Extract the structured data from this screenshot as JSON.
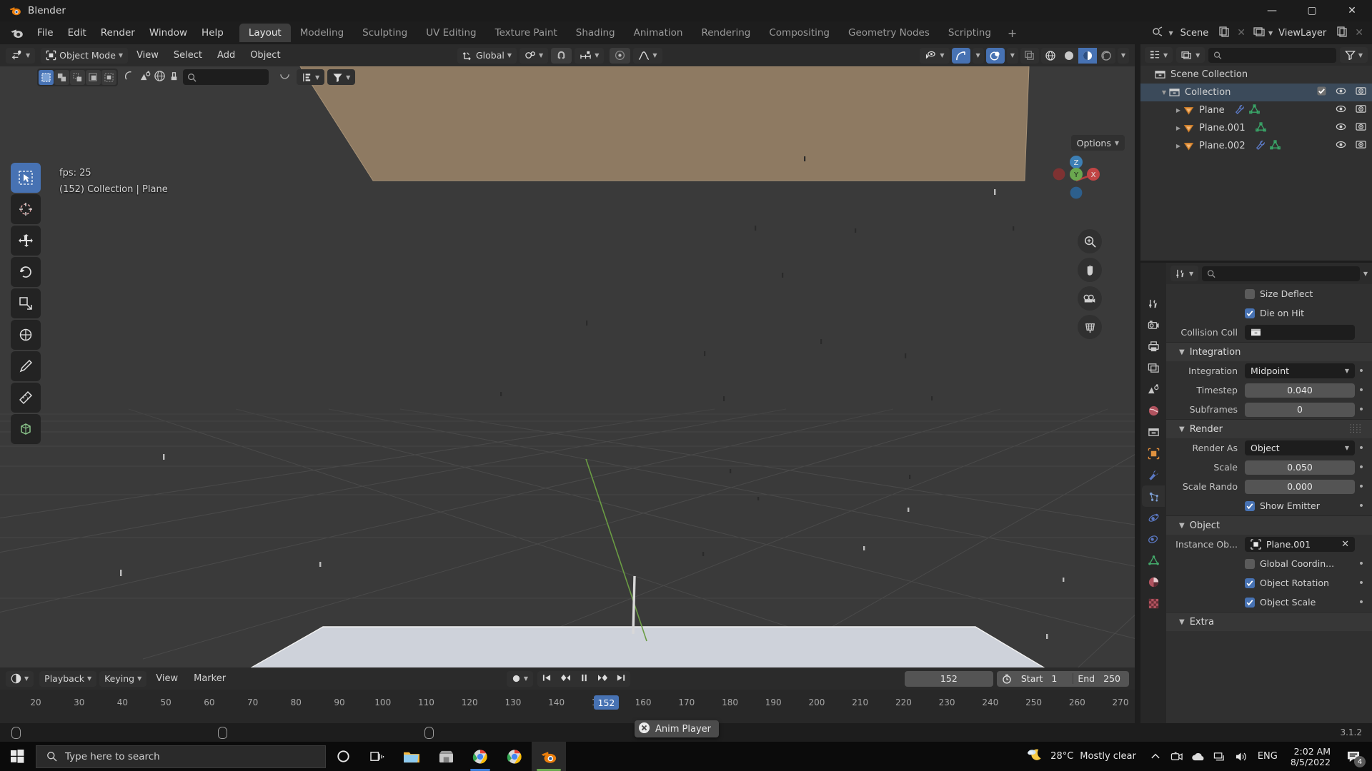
{
  "window": {
    "title": "Blender",
    "controls": {
      "minimize": "—",
      "maximize": "▢",
      "close": "✕"
    }
  },
  "topbar": {
    "menus": [
      "File",
      "Edit",
      "Render",
      "Window",
      "Help"
    ],
    "workspaces": [
      "Layout",
      "Modeling",
      "Sculpting",
      "UV Editing",
      "Texture Paint",
      "Shading",
      "Animation",
      "Rendering",
      "Compositing",
      "Geometry Nodes",
      "Scripting"
    ],
    "active_workspace": "Layout",
    "add_workspace": "+",
    "scene_name": "Scene",
    "view_layer_name": "ViewLayer"
  },
  "viewport": {
    "mode": "Object Mode",
    "menus": [
      "View",
      "Select",
      "Add",
      "Object"
    ],
    "transform_orientation": "Global",
    "options_label": "Options",
    "overlay_fps": "fps: 25",
    "overlay_info": "(152) Collection | Plane",
    "search_placeholder": "",
    "tools": [
      {
        "name": "tweak-tool",
        "active": true
      },
      {
        "name": "cursor-tool",
        "active": false
      },
      {
        "name": "move-tool",
        "active": false
      },
      {
        "name": "rotate-tool",
        "active": false
      },
      {
        "name": "scale-tool",
        "active": false
      },
      {
        "name": "transform-tool",
        "active": false
      },
      {
        "name": "annotate-tool",
        "active": false
      },
      {
        "name": "measure-tool",
        "active": false
      },
      {
        "name": "add-cube-tool",
        "active": false
      }
    ],
    "gizmo_axes": [
      "Z",
      "Y",
      "X"
    ]
  },
  "outliner": {
    "display_mode": "View Layer",
    "search_placeholder": "",
    "rows": [
      {
        "label": "Scene Collection",
        "indent": 0,
        "icon": "collection-icon",
        "disclosure": "",
        "selected": false,
        "checkbox": false,
        "eye": false,
        "camera": false,
        "modifier": false,
        "mesh": false
      },
      {
        "label": "Collection",
        "indent": 1,
        "icon": "collection-icon",
        "disclosure": "▼",
        "selected": true,
        "checkbox": true,
        "eye": true,
        "camera": true,
        "modifier": false,
        "mesh": false
      },
      {
        "label": "Plane",
        "indent": 2,
        "icon": "mesh-object-icon",
        "disclosure": "▶",
        "selected": false,
        "checkbox": false,
        "eye": true,
        "camera": true,
        "modifier": true,
        "mesh": true
      },
      {
        "label": "Plane.001",
        "indent": 2,
        "icon": "mesh-object-icon",
        "disclosure": "▶",
        "selected": false,
        "checkbox": false,
        "eye": true,
        "camera": true,
        "modifier": false,
        "mesh": true
      },
      {
        "label": "Plane.002",
        "indent": 2,
        "icon": "mesh-object-icon",
        "disclosure": "▶",
        "selected": false,
        "checkbox": false,
        "eye": true,
        "camera": true,
        "modifier": true,
        "mesh": true
      }
    ]
  },
  "properties": {
    "search_placeholder": "",
    "tabs": [
      {
        "name": "tool-tab",
        "active": false
      },
      {
        "name": "render-tab",
        "active": false
      },
      {
        "name": "output-tab",
        "active": false
      },
      {
        "name": "view-layer-tab",
        "active": false
      },
      {
        "name": "scene-tab",
        "active": false
      },
      {
        "name": "world-tab",
        "active": false
      },
      {
        "name": "collection-tab",
        "active": false
      },
      {
        "name": "object-tab",
        "active": false
      },
      {
        "name": "modifier-tab",
        "active": false
      },
      {
        "name": "particles-tab",
        "active": true
      },
      {
        "name": "physics-tab",
        "active": false
      },
      {
        "name": "constraints-tab",
        "active": false
      },
      {
        "name": "data-tab",
        "active": false
      },
      {
        "name": "material-tab",
        "active": false
      },
      {
        "name": "texture-tab",
        "active": false
      }
    ],
    "rows": [
      {
        "type": "checkbox",
        "label": "",
        "text": "Size Deflect",
        "checked": false,
        "dot": false
      },
      {
        "type": "checkbox",
        "label": "",
        "text": "Die on Hit",
        "checked": true,
        "dot": false
      },
      {
        "type": "collection-field",
        "label": "Collision Coll",
        "value": ""
      },
      {
        "type": "section",
        "text": "Integration",
        "grip": false
      },
      {
        "type": "dropdown",
        "label": "Integration",
        "value": "Midpoint",
        "dot": true
      },
      {
        "type": "value",
        "label": "Timestep",
        "value": "0.040",
        "dot": true
      },
      {
        "type": "value",
        "label": "Subframes",
        "value": "0",
        "dot": true
      },
      {
        "type": "section",
        "text": "Render",
        "grip": true
      },
      {
        "type": "dropdown",
        "label": "Render As",
        "value": "Object",
        "dot": true
      },
      {
        "type": "value",
        "label": "Scale",
        "value": "0.050",
        "dot": true
      },
      {
        "type": "value",
        "label": "Scale Rando",
        "value": "0.000",
        "dot": true
      },
      {
        "type": "checkbox",
        "label": "",
        "text": "Show Emitter",
        "checked": true,
        "dot": true
      },
      {
        "type": "section",
        "text": "Object",
        "grip": false
      },
      {
        "type": "object-field",
        "label": "Instance Ob...",
        "value": "Plane.001",
        "clear": "✕"
      },
      {
        "type": "checkbox",
        "label": "",
        "text": "Global Coordin...",
        "checked": false,
        "dot": true
      },
      {
        "type": "checkbox",
        "label": "",
        "text": "Object Rotation",
        "checked": true,
        "dot": true
      },
      {
        "type": "checkbox",
        "label": "",
        "text": "Object Scale",
        "checked": true,
        "dot": true
      },
      {
        "type": "section",
        "text": "Extra",
        "grip": false
      }
    ]
  },
  "timeline": {
    "menus": [
      "View",
      "Marker"
    ],
    "playback_label": "Playback",
    "keying_label": "Keying",
    "current_frame": "152",
    "start_label": "Start",
    "start_value": "1",
    "end_label": "End",
    "end_value": "250",
    "ticks": [
      "20",
      "30",
      "40",
      "50",
      "60",
      "70",
      "80",
      "90",
      "100",
      "110",
      "120",
      "130",
      "140",
      "150",
      "160",
      "170",
      "180",
      "190",
      "200",
      "210",
      "220",
      "230",
      "240",
      "250",
      "260",
      "270"
    ],
    "playhead_frame": "152"
  },
  "statusbar": {
    "version": "3.1.2"
  },
  "tooltip": {
    "anim_player": "Anim Player"
  },
  "taskbar": {
    "search_placeholder": "Type here to search",
    "weather_temp": "28°C",
    "weather_desc": "Mostly clear",
    "language": "ENG",
    "time": "2:02 AM",
    "date": "8/5/2022",
    "notification_count": "4",
    "apps": [
      {
        "name": "file-explorer-icon",
        "active": false
      },
      {
        "name": "store-icon",
        "active": false
      },
      {
        "name": "chrome-dev-icon",
        "active": false
      },
      {
        "name": "chrome-icon",
        "active": false
      },
      {
        "name": "blender-icon",
        "active": true
      }
    ]
  },
  "colors": {
    "accent": "#4772b3",
    "blender_orange": "#e87d0d",
    "panel_bg": "#303030",
    "header_bg": "#2b2b2b",
    "viewport_bg": "#393939"
  }
}
